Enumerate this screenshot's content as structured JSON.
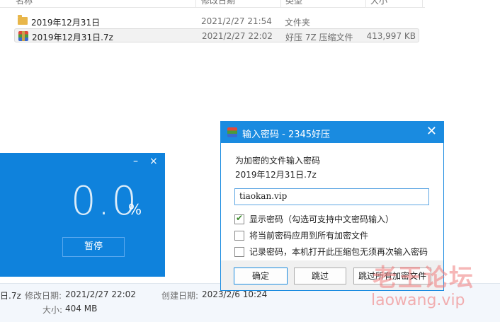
{
  "explorer": {
    "columns": {
      "name": "名称",
      "date": "修改日期",
      "type": "类型",
      "size": "大小"
    },
    "files": [
      {
        "name": "2019年12月31日",
        "date": "2021/2/27 21:54",
        "type": "文件夹",
        "size": "",
        "icon": "folder-icon"
      },
      {
        "name": "2019年12月31日.7z",
        "date": "2021/2/27 22:02",
        "type": "好压 7Z 压缩文件",
        "size": "413,997 KB",
        "icon": "archive-icon"
      }
    ]
  },
  "progress": {
    "percent": "0.0",
    "percent_sign": "%",
    "pause_label": "暂停",
    "min_symbol": "–",
    "close_symbol": "×"
  },
  "status": {
    "filename": "日.7z",
    "modified_label": "修改日期:",
    "modified_value": "2021/2/27 22:02",
    "created_label": "创建日期:",
    "created_value": "2023/2/6 10:24",
    "size_label": "大小:",
    "size_value": "404 MB"
  },
  "dialog": {
    "title": "输入密码 - 2345好压",
    "close_symbol": "✕",
    "prompt": "为加密的文件输入密码",
    "filename": "2019年12月31日.7z",
    "password_value": "tiaokan.vip",
    "options": [
      {
        "label": "显示密码（勾选可支持中文密码输入）",
        "checked": true
      },
      {
        "label": "将当前密码应用到所有加密文件",
        "checked": false
      },
      {
        "label": "记录密码，本机打开此压缩包无须再次输入密码",
        "checked": false
      }
    ],
    "buttons": {
      "ok": "确定",
      "skip": "跳过",
      "skip_all": "跳过所有加密文件"
    }
  },
  "watermark": {
    "cn": "老王论坛",
    "en": "laowang.vip"
  },
  "colors": {
    "accent": "#1a8be0",
    "progress_bg": "#0f82dc",
    "watermark": "#f07d7d"
  }
}
